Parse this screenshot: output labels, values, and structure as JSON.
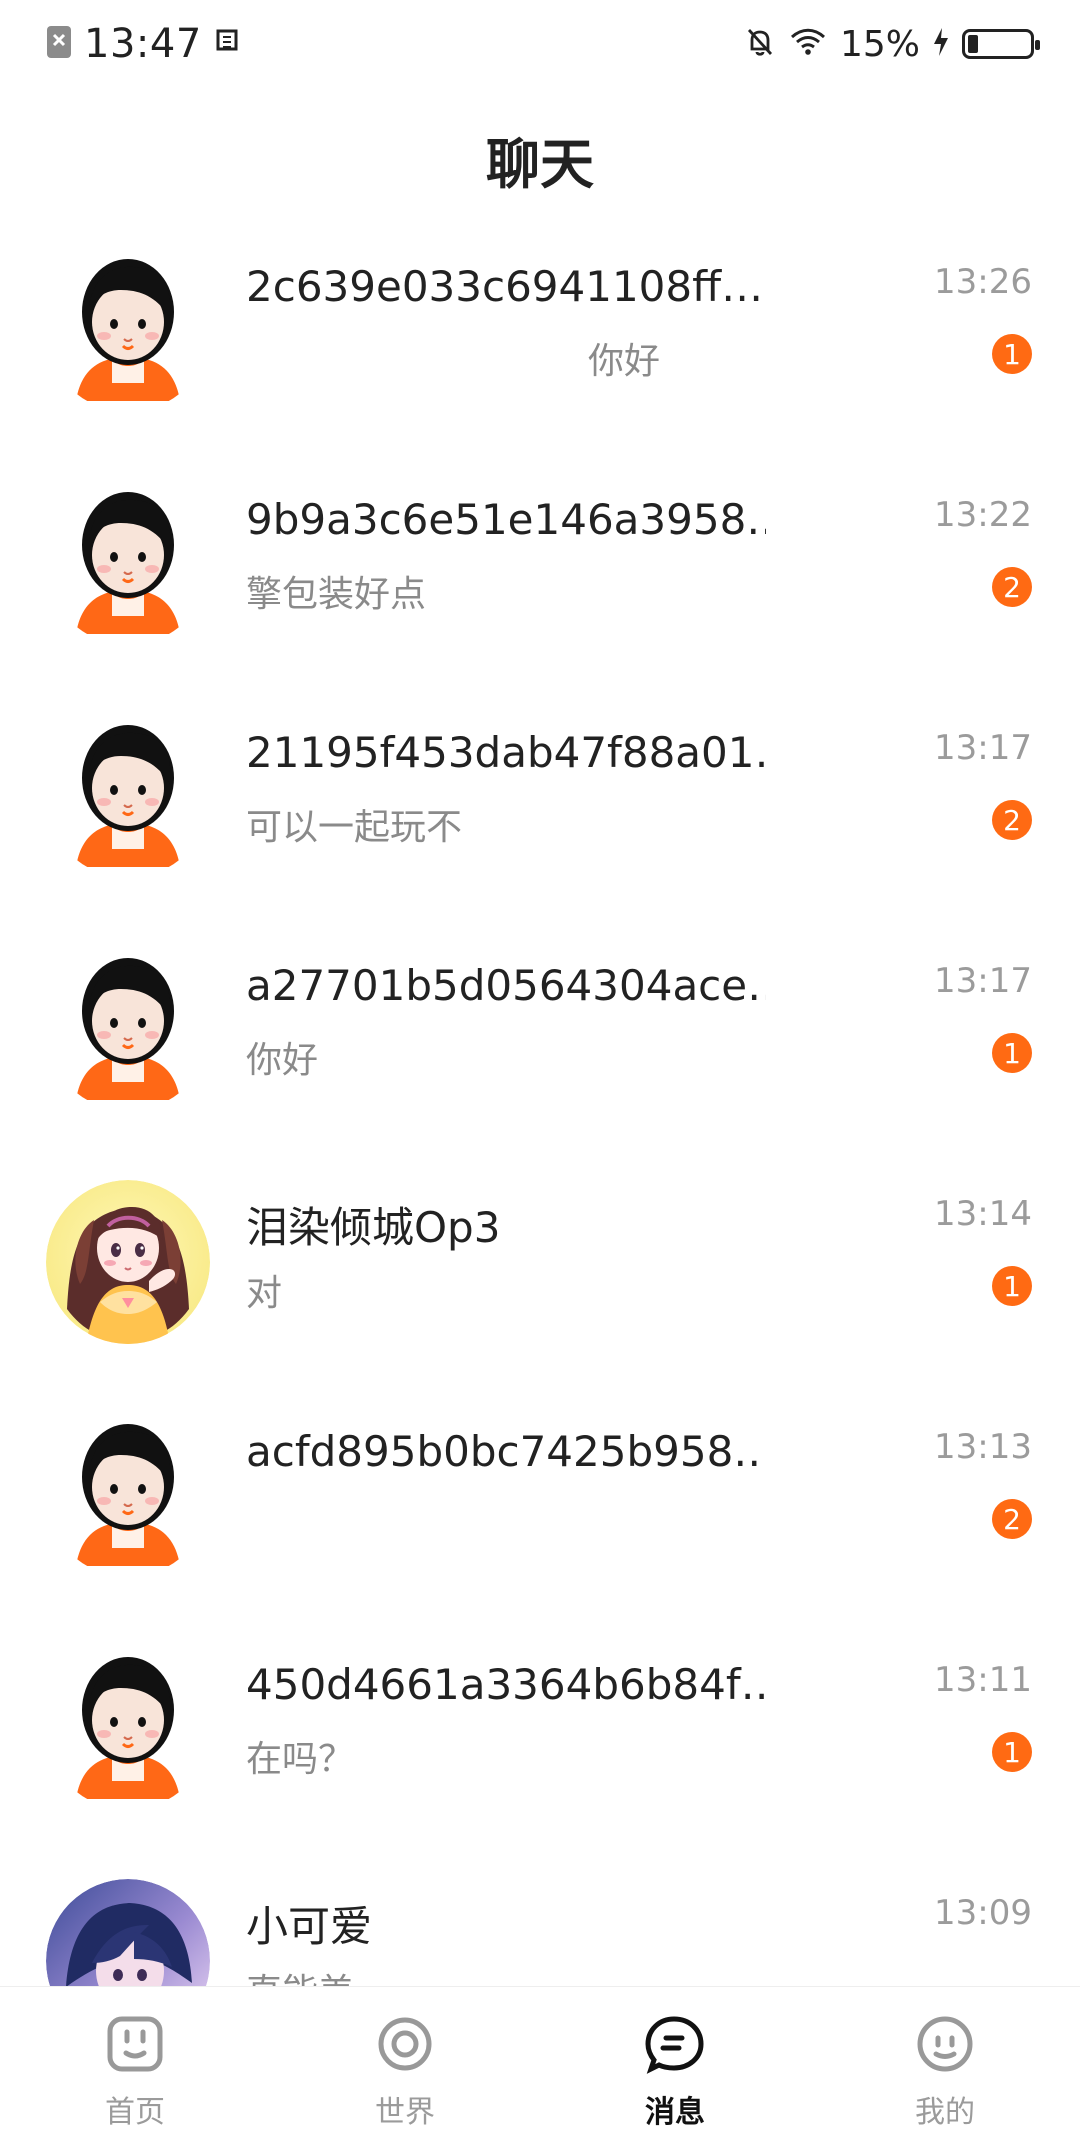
{
  "status_bar": {
    "time": "13:47",
    "battery": "15%"
  },
  "header": {
    "title": "聊天"
  },
  "chat_list": [
    {
      "name": "2c639e033c6941108ff…",
      "preview": "你好",
      "time": "13:26",
      "badge": "1",
      "avatar": "default-boy-avatar"
    },
    {
      "name": "9b9a3c6e51e146a3958…",
      "preview": "擎包装好点",
      "time": "13:22",
      "badge": "2",
      "avatar": "default-boy-avatar"
    },
    {
      "name": "21195f453dab47f88a01…",
      "preview": "可以一起玩不",
      "time": "13:17",
      "badge": "2",
      "avatar": "default-boy-avatar"
    },
    {
      "name": "a27701b5d0564304ace…",
      "preview": "你好",
      "time": "13:17",
      "badge": "1",
      "avatar": "default-boy-avatar"
    },
    {
      "name": "泪染倾城Op3",
      "preview": "对",
      "time": "13:14",
      "badge": "1",
      "avatar": "girl-photo-avatar"
    },
    {
      "name": "acfd895b0bc7425b958…",
      "preview": "",
      "time": "13:13",
      "badge": "2",
      "avatar": "default-boy-avatar"
    },
    {
      "name": "450d4661a3364b6b84f…",
      "preview": "在吗？",
      "time": "13:11",
      "badge": "1",
      "avatar": "default-boy-avatar"
    },
    {
      "name": "小可爱",
      "preview": "直能美",
      "time": "13:09",
      "badge": "",
      "avatar": "anime-photo-avatar"
    }
  ],
  "bottom_nav": [
    {
      "label": "首页",
      "icon": "home-icon",
      "active": false
    },
    {
      "label": "世界",
      "icon": "world-icon",
      "active": false
    },
    {
      "label": "消息",
      "icon": "message-icon",
      "active": true
    },
    {
      "label": "我的",
      "icon": "profile-icon",
      "active": false
    }
  ],
  "colors": {
    "accent": "#ff6a13",
    "text_primary": "#222222",
    "text_secondary": "#8a8a8a"
  }
}
